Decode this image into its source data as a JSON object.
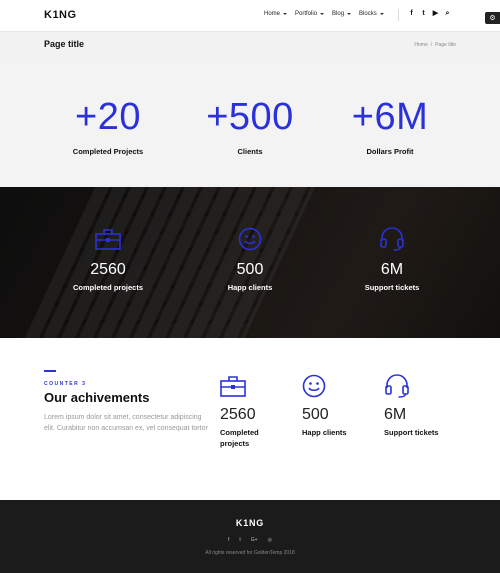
{
  "header": {
    "logo": "K1NG",
    "nav": [
      {
        "label": "Home"
      },
      {
        "label": "Portfolio"
      },
      {
        "label": "Blog"
      },
      {
        "label": "Blocks"
      }
    ],
    "social_icons": [
      "facebook-icon",
      "twitter-icon",
      "youtube-icon",
      "search-icon"
    ],
    "social_glyphs": [
      "f",
      "t",
      "▶",
      "⌕"
    ]
  },
  "title_bar": {
    "title": "Page title",
    "breadcrumb": [
      "Home",
      "/",
      "Page title"
    ]
  },
  "counter1": {
    "items": [
      {
        "number": "+20",
        "label": "Completed Projects"
      },
      {
        "number": "+500",
        "label": "Clients"
      },
      {
        "number": "+6M",
        "label": "Dollars Profit"
      }
    ]
  },
  "counter2": {
    "items": [
      {
        "icon": "briefcase-icon",
        "number": "2560",
        "label": "Completed projects"
      },
      {
        "icon": "smiley-icon",
        "number": "500",
        "label": "Happ clients"
      },
      {
        "icon": "headset-icon",
        "number": "6M",
        "label": "Support tickets"
      }
    ]
  },
  "counter3": {
    "eyebrow": "COUNTER 3",
    "heading": "Our achivements",
    "text": "Lorem ipsum dolor sit amet, consectetur adipiscing elit. Curabitur non accumsan ex, vel consequat tortor",
    "items": [
      {
        "icon": "briefcase-icon",
        "number": "2560",
        "label": "Completed projects"
      },
      {
        "icon": "smiley-icon",
        "number": "500",
        "label": "Happ clients"
      },
      {
        "icon": "headset-icon",
        "number": "6M",
        "label": "Support tickets"
      }
    ]
  },
  "footer": {
    "logo": "K1NG",
    "social_icons": [
      "facebook-icon",
      "twitter-icon",
      "google-plus-icon",
      "instagram-icon"
    ],
    "social_glyphs": [
      "f",
      "t",
      "G+",
      "◎"
    ],
    "copyright": "All rights reserved for GoldenTemp 2018"
  },
  "colors": {
    "accent": "#2a31d8",
    "dark_bg": "#1b1b1b",
    "light_bg": "#f3f3f3"
  }
}
